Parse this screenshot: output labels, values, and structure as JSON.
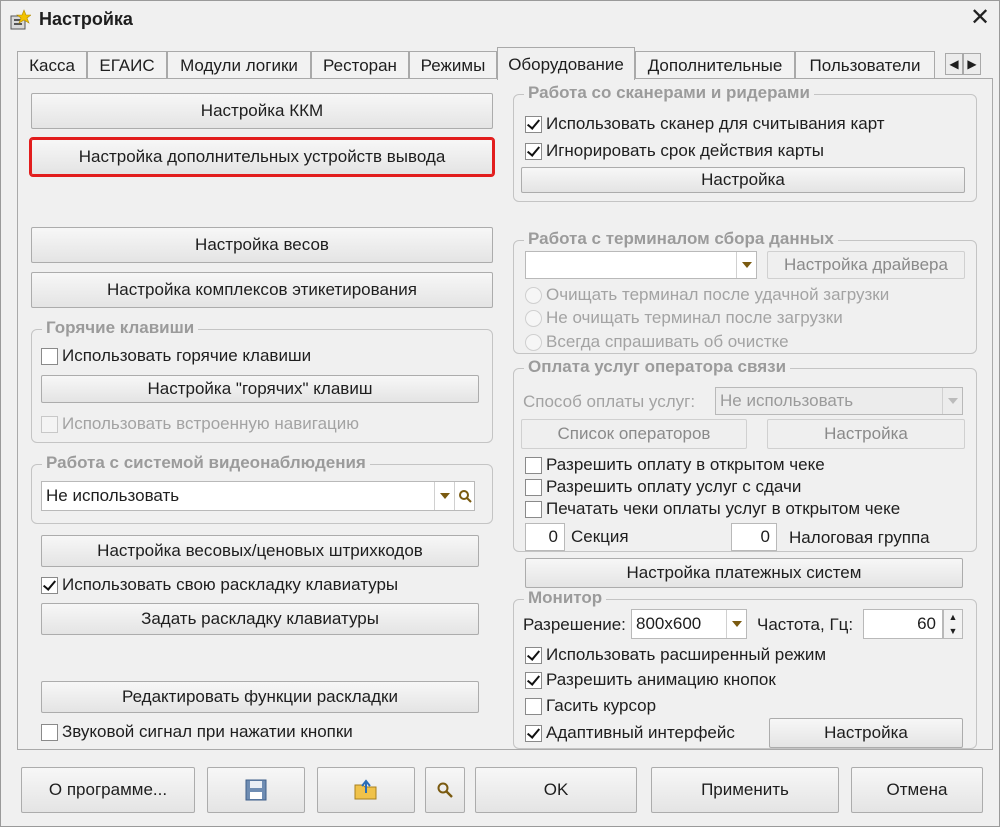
{
  "window": {
    "title": "Настройка",
    "close": "✕"
  },
  "tabs": [
    "Касса",
    "ЕГАИС",
    "Модули логики",
    "Ресторан",
    "Режимы",
    "Оборудование",
    "Дополнительные",
    "Пользователи"
  ],
  "left": {
    "btn_kkm": "Настройка ККМ",
    "btn_extra_output": "Настройка дополнительных устройств вывода",
    "btn_scales": "Настройка весов",
    "btn_labeling": "Настройка комплексов этикетирования",
    "hotkeys": {
      "title": "Горячие клавиши",
      "use_hotkeys": "Использовать горячие клавиши",
      "btn_hotkeys": "Настройка \"горячих\" клавиш",
      "use_builtin_nav": "Использовать встроенную навигацию"
    },
    "video": {
      "title": "Работа с системой видеонаблюдения",
      "value": "Не использовать"
    },
    "btn_barcodes": "Настройка весовых/ценовых штрихкодов",
    "use_own_layout": "Использовать свою раскладку клавиатуры",
    "btn_set_layout": "Задать раскладку клавиатуры",
    "btn_edit_layout": "Редактировать функции раскладки",
    "sound_signal": "Звуковой сигнал при нажатии кнопки"
  },
  "right": {
    "scanners": {
      "title": "Работа со сканерами и ридерами",
      "use_scanner": "Использовать сканер для считывания карт",
      "ignore_expiry": "Игнорировать срок действия карты",
      "btn_setup": "Настройка"
    },
    "terminal": {
      "title": "Работа с терминалом сбора данных",
      "combo_value": "",
      "btn_driver": "Настройка драйвера",
      "opt_clear_success": "Очищать терминал после удачной загрузки",
      "opt_no_clear": "Не очищать терминал после загрузки",
      "opt_always_ask": "Всегда спрашивать об очистке"
    },
    "operator": {
      "title": "Оплата услуг оператора связи",
      "payment_label": "Способ оплаты услуг:",
      "payment_value": "Не использовать",
      "btn_operators": "Список операторов",
      "btn_setup": "Настройка",
      "allow_open_check": "Разрешить оплату в открытом чеке",
      "allow_from_change": "Разрешить оплату услуг с сдачи",
      "print_in_open_check": "Печатать чеки оплаты услуг в открытом чеке",
      "section_value": "0",
      "section_label": "Секция",
      "tax_value": "0",
      "tax_label": "Налоговая группа"
    },
    "btn_payment_systems": "Настройка платежных систем",
    "monitor": {
      "title": "Монитор",
      "resolution_label": "Разрешение:",
      "resolution_value": "800x600",
      "freq_label": "Частота, Гц:",
      "freq_value": "60",
      "extended_mode": "Использовать расширенный режим",
      "button_animation": "Разрешить анимацию кнопок",
      "hide_cursor": "Гасить курсор",
      "adaptive_ui": "Адаптивный интерфейс",
      "btn_setup": "Настройка"
    }
  },
  "footer": {
    "about": "О программе...",
    "ok": "OK",
    "apply": "Применить",
    "cancel": "Отмена"
  },
  "colors": {
    "focus_outline": "#e21d1d",
    "group_title": "#9b9b9b"
  }
}
